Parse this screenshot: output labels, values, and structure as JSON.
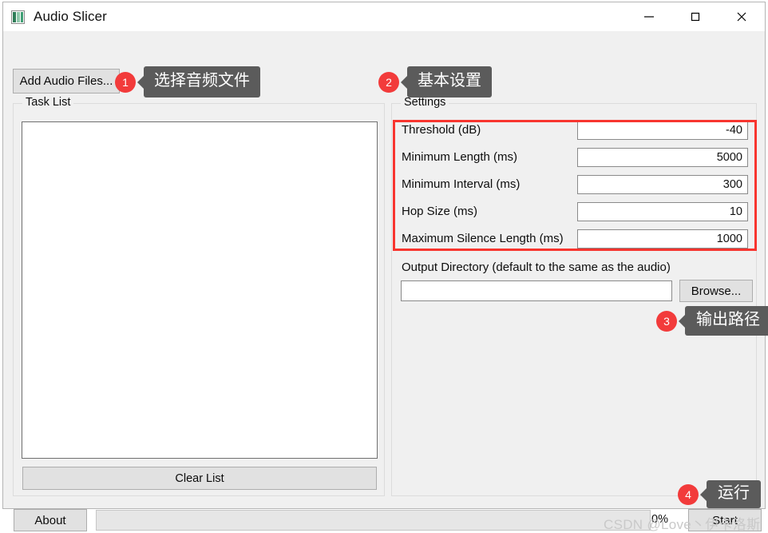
{
  "window": {
    "title": "Audio Slicer",
    "icon": "audio-waveform-icon",
    "controls": {
      "minimize": "—",
      "maximize": "□",
      "close": "✕"
    }
  },
  "toolbar": {
    "add_audio_label": "Add Audio Files..."
  },
  "task_panel": {
    "title": "Task List",
    "items": [],
    "clear_label": "Clear List"
  },
  "settings_panel": {
    "title": "Settings",
    "rows": [
      {
        "label": "Threshold (dB)",
        "value": "-40"
      },
      {
        "label": "Minimum Length (ms)",
        "value": "5000"
      },
      {
        "label": "Minimum Interval (ms)",
        "value": "300"
      },
      {
        "label": "Hop Size (ms)",
        "value": "10"
      },
      {
        "label": "Maximum Silence Length (ms)",
        "value": "1000"
      }
    ],
    "output_dir_label": "Output Directory (default to the same as the audio)",
    "output_dir_value": "",
    "browse_label": "Browse...",
    "highlight_color": "#f8352f"
  },
  "bottom_bar": {
    "about_label": "About",
    "progress_percent": "0%",
    "progress_value": 0,
    "start_label": "Start"
  },
  "callouts": [
    {
      "number": "1",
      "text": "选择音频文件"
    },
    {
      "number": "2",
      "text": "基本设置"
    },
    {
      "number": "3",
      "text": "输出路径"
    },
    {
      "number": "4",
      "text": "运行"
    }
  ],
  "watermark": "CSDN @Love丶伊卡洛斯"
}
